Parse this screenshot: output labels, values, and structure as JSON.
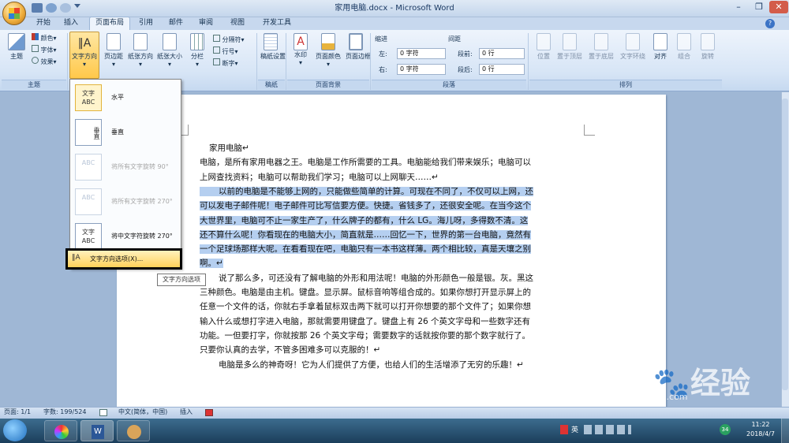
{
  "window": {
    "title": "家用电脑.docx - Microsoft Word"
  },
  "tabs": [
    "开始",
    "插入",
    "页面布局",
    "引用",
    "邮件",
    "审阅",
    "视图",
    "开发工具"
  ],
  "active_tab": "页面布局",
  "ribbon": {
    "theme_group": {
      "label": "主题",
      "themes_btn": "主题",
      "colors": "颜色",
      "fonts": "字体",
      "effects": "效果"
    },
    "page_setup_group": {
      "text_direction": "文字方向",
      "margins": "页边距",
      "orientation": "纸张方向",
      "size": "纸张大小",
      "columns": "分栏",
      "breaks": "分隔符",
      "line_numbers": "行号",
      "hyphenation": "断字"
    },
    "draft_group": {
      "label": "稿纸",
      "draft_settings": "稿纸设置"
    },
    "background_group": {
      "label": "页面背景",
      "watermark": "水印",
      "page_color": "页面颜色",
      "page_borders": "页面边框"
    },
    "paragraph_group": {
      "label": "段落",
      "indent": "缩进",
      "left": "左:",
      "left_value": "0 字符",
      "right": "右:",
      "right_value": "0 字符",
      "spacing": "间距",
      "before": "段前:",
      "before_value": "0 行",
      "after": "段后:",
      "after_value": "0 行"
    },
    "arrange_group": {
      "label": "排列",
      "position": "位置",
      "bring_front": "置于顶层",
      "send_back": "置于底层",
      "text_wrap": "文字环绕",
      "align": "对齐",
      "group": "组合",
      "rotate": "旋转"
    }
  },
  "text_direction_menu": {
    "items": [
      {
        "icon_text": "文字 ABC",
        "label": "水平",
        "enabled": true
      },
      {
        "icon_text": "垂直",
        "label": "垂直",
        "enabled": true
      },
      {
        "icon_text": "ABC",
        "label": "将所有文字旋转 90°",
        "enabled": false
      },
      {
        "icon_text": "ABC",
        "label": "将所有文字旋转 270°",
        "enabled": false
      },
      {
        "icon_text": "文字 ABC",
        "label": "将中文字符旋转 270°",
        "enabled": true
      }
    ],
    "options": "文字方向选项(X)...",
    "tooltip": "文字方向选项"
  },
  "document": {
    "lines": [
      {
        "text": "家用电脑↵",
        "hl": false,
        "indent": 12
      },
      {
        "text": "电脑，是所有家用电器之王。电脑是工作所需要的工具。电脑能给我们带来娱乐；电脑可以",
        "hl": false,
        "indent": 0
      },
      {
        "text": "上网查找资料；电脑可以帮助我们学习；电脑可以上网聊天……↵",
        "hl": false,
        "indent": 0
      },
      {
        "text": "以前的电脑是不能够上网的，只能做些简单的计算。可现在不同了，不仅可以上网，还",
        "hl": true,
        "indent": 24
      },
      {
        "text": "可以发电子邮件呢！电子邮件可比写信要方便。快捷。省钱多了，还很安全呢。在当今这个",
        "hl": true,
        "indent": 0
      },
      {
        "text": "大世界里，电脑可不止一家生产了，什么牌子的都有，什么 LG。海儿呀，多得数不清。这",
        "hl": true,
        "indent": 0
      },
      {
        "text": "还不算什么呢！你看现在的电脑大小，简直就是……回忆一下，世界的第一台电脑，竟然有",
        "hl": true,
        "indent": 0
      },
      {
        "text": "一个足球场那样大呢。在看看现在吧，电脑只有一本书这样薄。两个相比较，真是天壤之别",
        "hl": true,
        "indent": 0
      },
      {
        "text": "啊。↵",
        "hl": true,
        "indent": 0
      },
      {
        "text": "说了那么多，可还没有了解电脑的外形和用法呢！电脑的外形颜色一般是银。灰。黑这",
        "hl": false,
        "indent": 24
      },
      {
        "text": "三种颜色。电脑是由主机。键盘。显示屏。鼠标音响等组合成的。如果你想打开显示屏上的",
        "hl": false,
        "indent": 0
      },
      {
        "text": "任意一个文件的话，你就右手拿着鼠标双击两下就可以打开你想要的那个文件了；如果你想",
        "hl": false,
        "indent": 0
      },
      {
        "text": "输入什么或想打字进入电脑，那就需要用键盘了。键盘上有 26 个英文字母和一些数字还有",
        "hl": false,
        "indent": 0
      },
      {
        "text": "功能。一但要打字，你就按那 26 个英文字母；需要数字的话就按你要的那个数字就行了。",
        "hl": false,
        "indent": 0
      },
      {
        "text": "只要你认真的去学，不管多困难多可以克服的！↵",
        "hl": false,
        "indent": 0
      },
      {
        "text": "电脑是多么的神奇呀！它为人们提供了方便，也给人们的生活增添了无穷的乐趣！↵",
        "hl": false,
        "indent": 24
      }
    ]
  },
  "statusbar": {
    "page": "页面: 1/1",
    "words": "字数: 199/524",
    "language": "中文(简体，中国)",
    "mode": "插入"
  },
  "taskbar": {
    "tray_lang": "英",
    "time": "11:22",
    "date": "2018/4/7",
    "badge": "34"
  },
  "watermark": {
    "main": "Bai🐾经验",
    "sub": "jingyan.baidu.com"
  }
}
